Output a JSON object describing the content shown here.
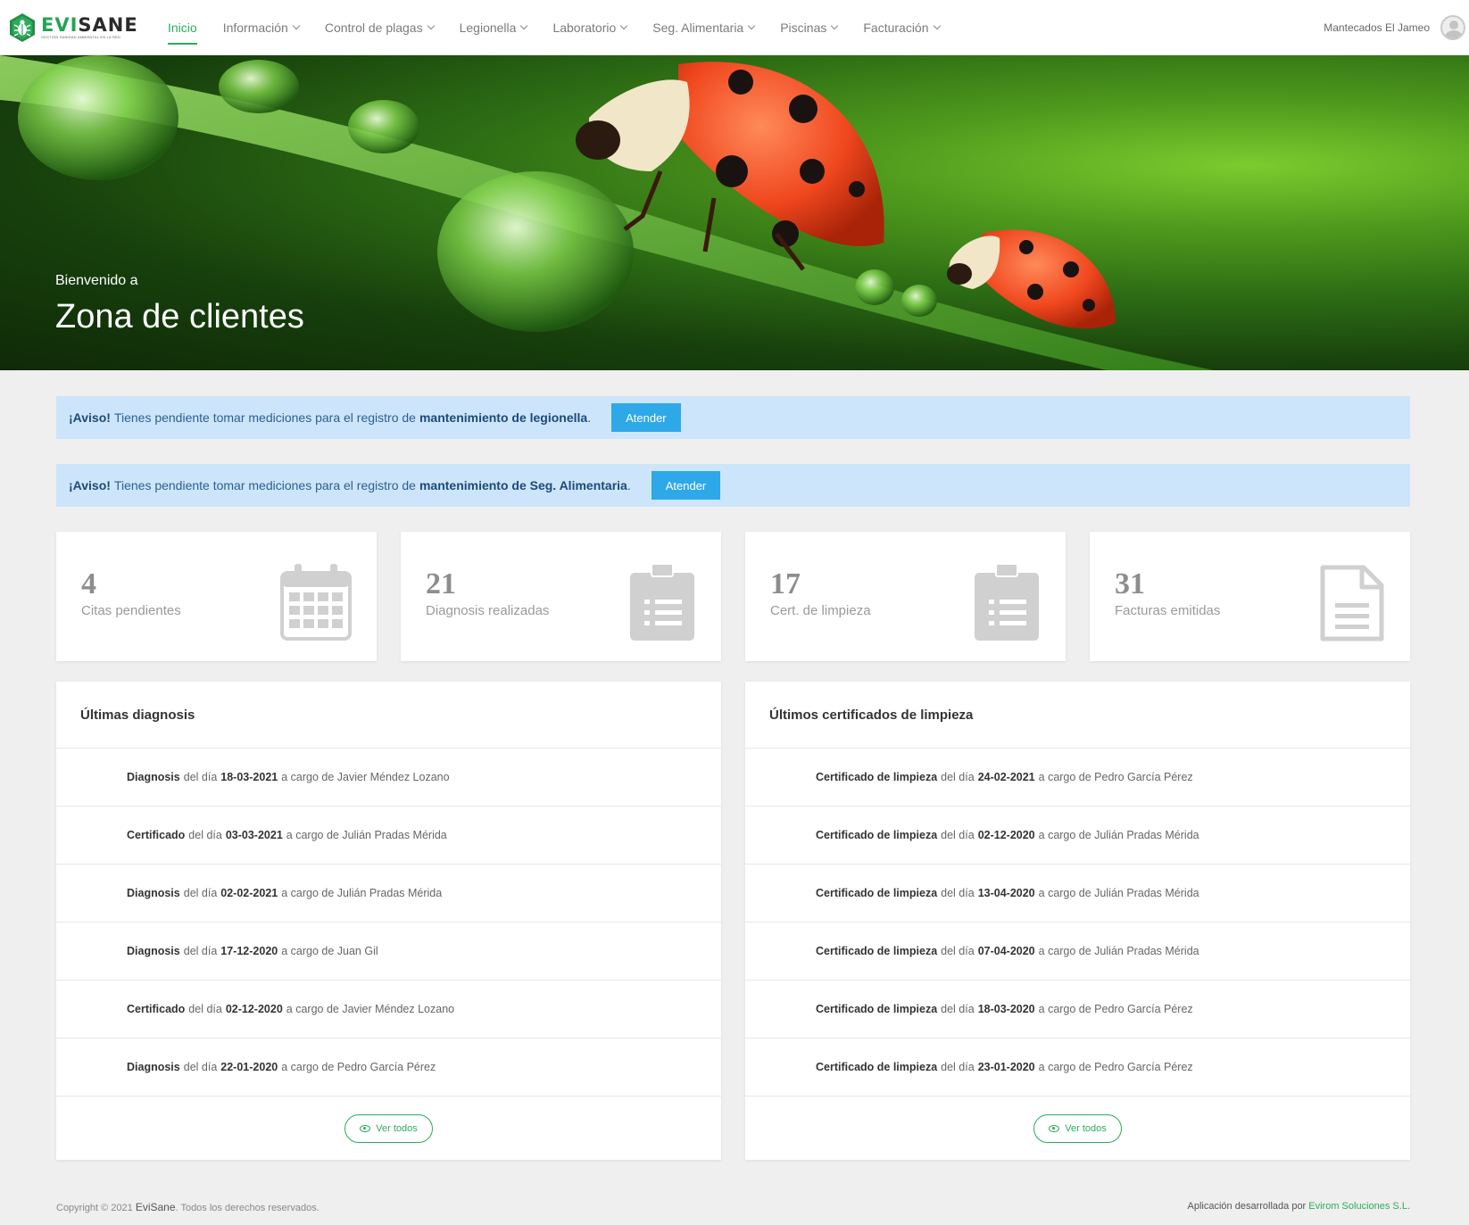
{
  "brand": {
    "name_part1": "EVI",
    "name_part2": "SANE",
    "tagline": "GESTIÓN SANIDAD AMBIENTAL EN LA RED"
  },
  "nav": {
    "items": [
      {
        "label": "Inicio",
        "active": true,
        "dropdown": false
      },
      {
        "label": "Información",
        "dropdown": true
      },
      {
        "label": "Control de plagas",
        "dropdown": true
      },
      {
        "label": "Legionella",
        "dropdown": true
      },
      {
        "label": "Laboratorio",
        "dropdown": true
      },
      {
        "label": "Seg. Alimentaria",
        "dropdown": true
      },
      {
        "label": "Piscinas",
        "dropdown": true
      },
      {
        "label": "Facturación",
        "dropdown": true
      }
    ],
    "user_name": "Mantecados El Jameo"
  },
  "hero": {
    "subtitle": "Bienvenido a",
    "title": "Zona de clientes"
  },
  "alerts": [
    {
      "strong": "¡Aviso!",
      "text": "Tienes pendiente tomar mediciones para el registro de",
      "target": "mantenimiento de legionella",
      "end": ".",
      "button": "Atender"
    },
    {
      "strong": "¡Aviso!",
      "text": "Tienes pendiente tomar mediciones para el registro de",
      "target": "mantenimiento de Seg. Alimentaria",
      "end": ".",
      "button": "Atender"
    }
  ],
  "stats": [
    {
      "value": "4",
      "label": "Citas pendientes",
      "icon": "calendar-icon"
    },
    {
      "value": "21",
      "label": "Diagnosis realizadas",
      "icon": "clipboard-icon"
    },
    {
      "value": "17",
      "label": "Cert. de limpieza",
      "icon": "clipboard-icon"
    },
    {
      "value": "31",
      "label": "Facturas emitidas",
      "icon": "document-icon"
    }
  ],
  "panels": {
    "left": {
      "title": "Últimas diagnosis",
      "rows": [
        {
          "type": "Diagnosis",
          "pre": "del día",
          "date": "18-03-2021",
          "post": "a cargo de Javier Méndez Lozano"
        },
        {
          "type": "Certificado",
          "pre": "del día",
          "date": "03-03-2021",
          "post": "a cargo de Julián Pradas Mérida"
        },
        {
          "type": "Diagnosis",
          "pre": "del día",
          "date": "02-02-2021",
          "post": "a cargo de Julián Pradas Mérida"
        },
        {
          "type": "Diagnosis",
          "pre": "del día",
          "date": "17-12-2020",
          "post": "a cargo de Juan Gil"
        },
        {
          "type": "Certificado",
          "pre": "del día",
          "date": "02-12-2020",
          "post": "a cargo de Javier Méndez Lozano"
        },
        {
          "type": "Diagnosis",
          "pre": "del día",
          "date": "22-01-2020",
          "post": "a cargo de Pedro García Pérez"
        }
      ],
      "button": "Ver todos"
    },
    "right": {
      "title": "Últimos certificados de limpieza",
      "rows": [
        {
          "type": "Certificado de limpieza",
          "pre": "del día",
          "date": "24-02-2021",
          "post": "a cargo de Pedro García Pérez"
        },
        {
          "type": "Certificado de limpieza",
          "pre": "del día",
          "date": "02-12-2020",
          "post": "a cargo de Julián Pradas Mérida"
        },
        {
          "type": "Certificado de limpieza",
          "pre": "del día",
          "date": "13-04-2020",
          "post": "a cargo de Julián Pradas Mérida"
        },
        {
          "type": "Certificado de limpieza",
          "pre": "del día",
          "date": "07-04-2020",
          "post": "a cargo de Julián Pradas Mérida"
        },
        {
          "type": "Certificado de limpieza",
          "pre": "del día",
          "date": "18-03-2020",
          "post": "a cargo de Pedro García Pérez"
        },
        {
          "type": "Certificado de limpieza",
          "pre": "del día",
          "date": "23-01-2020",
          "post": "a cargo de Pedro García Pérez"
        }
      ],
      "button": "Ver todos"
    }
  },
  "footer": {
    "copyright_pre": "Copyright © 2021",
    "brand": "EviSane",
    "copyright_post": ". Todos los derechos reservados.",
    "dev_pre": "Aplicación desarrollada por",
    "dev_link": "Evirom Soluciones S.L."
  },
  "colors": {
    "accent": "#2bac5c",
    "alert_bg": "#cde5fb",
    "button_blue": "#2da8e8"
  }
}
